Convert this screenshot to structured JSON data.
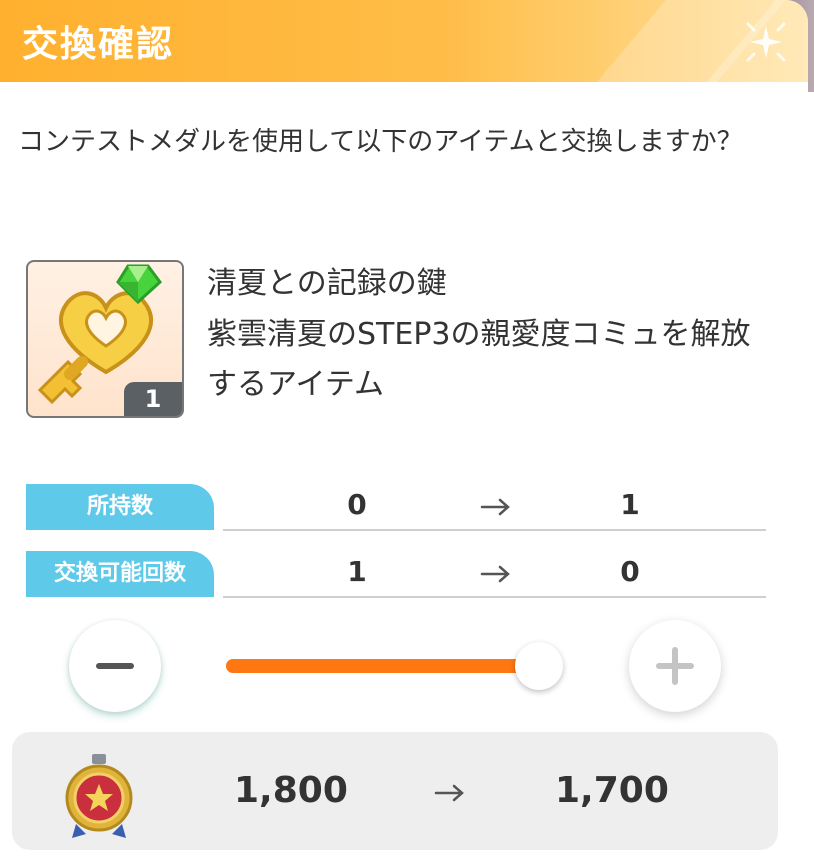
{
  "dialog": {
    "title": "交換確認",
    "message": "コンテストメダルを使用して以下のアイテムと交換しますか？"
  },
  "item": {
    "name": "清夏との記録の鍵",
    "description": "紫雲清夏のSTEP3の親愛度コミュを解放するアイテム",
    "quantity": "1",
    "icon": "golden-heart-key-icon"
  },
  "stats": [
    {
      "label": "所持数",
      "from": "0",
      "to": "1"
    },
    {
      "label": "交換可能回数",
      "from": "1",
      "to": "0"
    }
  ],
  "slider": {
    "value": 1,
    "min": 0,
    "max": 1,
    "fill_color": "#ff7711"
  },
  "cost": {
    "currency_icon": "contest-medal-icon",
    "from": "1,800",
    "to": "1,700"
  },
  "colors": {
    "header": "#ffb02e",
    "label_bg": "#5fc9e9",
    "accent": "#ff7711"
  }
}
